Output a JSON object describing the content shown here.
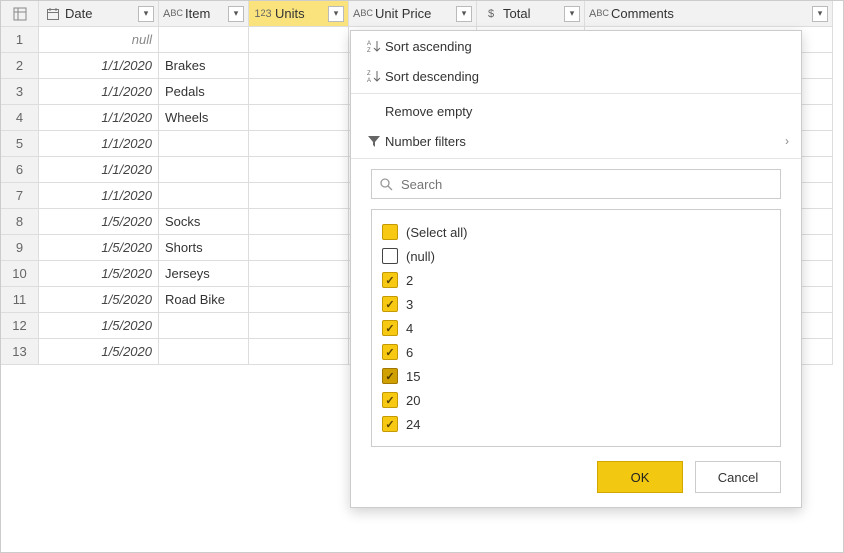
{
  "columns": {
    "date": "Date",
    "item": "Item",
    "units": "Units",
    "unit_price": "Unit Price",
    "total": "Total",
    "comments": "Comments"
  },
  "rows": [
    {
      "n": "1",
      "date": "null",
      "item": "",
      "null_date": true
    },
    {
      "n": "2",
      "date": "1/1/2020",
      "item": "Brakes"
    },
    {
      "n": "3",
      "date": "1/1/2020",
      "item": "Pedals"
    },
    {
      "n": "4",
      "date": "1/1/2020",
      "item": "Wheels"
    },
    {
      "n": "5",
      "date": "1/1/2020",
      "item": ""
    },
    {
      "n": "6",
      "date": "1/1/2020",
      "item": ""
    },
    {
      "n": "7",
      "date": "1/1/2020",
      "item": ""
    },
    {
      "n": "8",
      "date": "1/5/2020",
      "item": "Socks"
    },
    {
      "n": "9",
      "date": "1/5/2020",
      "item": "Shorts"
    },
    {
      "n": "10",
      "date": "1/5/2020",
      "item": "Jerseys"
    },
    {
      "n": "11",
      "date": "1/5/2020",
      "item": "Road Bike"
    },
    {
      "n": "12",
      "date": "1/5/2020",
      "item": ""
    },
    {
      "n": "13",
      "date": "1/5/2020",
      "item": ""
    }
  ],
  "flyout": {
    "sort_asc": "Sort ascending",
    "sort_desc": "Sort descending",
    "remove_empty": "Remove empty",
    "num_filters": "Number filters",
    "search_placeholder": "Search",
    "select_all": "(Select all)",
    "null_opt": "(null)",
    "values": [
      "2",
      "3",
      "4",
      "6",
      "15",
      "20",
      "24"
    ],
    "ok": "OK",
    "cancel": "Cancel"
  }
}
